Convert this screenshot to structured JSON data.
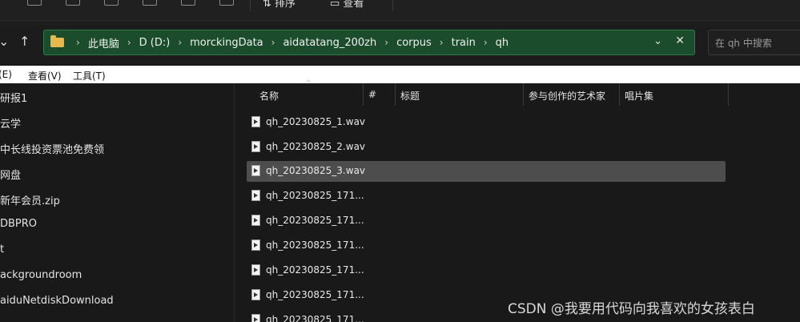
{
  "toolbar": {
    "sort_label": "排序",
    "view_label": "查看"
  },
  "nav": {
    "breadcrumbs": [
      "此电脑",
      "D (D:)",
      "morckingData",
      "aidatatang_200zh",
      "corpus",
      "train",
      "qh"
    ],
    "search_placeholder": "在 qh 中搜索"
  },
  "menubar": {
    "items": [
      "编辑(E)",
      "查看(V)",
      "工具(T)"
    ],
    "edit_visible": "(E)"
  },
  "left_pane": {
    "items": [
      "研报1",
      "云学",
      "中长线投资票池免费领",
      "网盘",
      "新年会员.zip",
      "DBPRO",
      "t",
      "ackgroundroom",
      "aiduNetdiskDownload"
    ]
  },
  "columns": [
    "名称",
    "#",
    "标题",
    "参与创作的艺术家",
    "唱片集"
  ],
  "files": [
    "qh_20230825_1.wav",
    "qh_20230825_2.wav",
    "qh_20230825_3.wav",
    "qh_20230825_171...",
    "qh_20230825_171...",
    "qh_20230825_171...",
    "qh_20230825_171...",
    "qh_20230825_171...",
    "qh_20230825_171..."
  ],
  "selected_file_index": 2,
  "watermark": "CSDN @我要用代码向我喜欢的女孩表白"
}
